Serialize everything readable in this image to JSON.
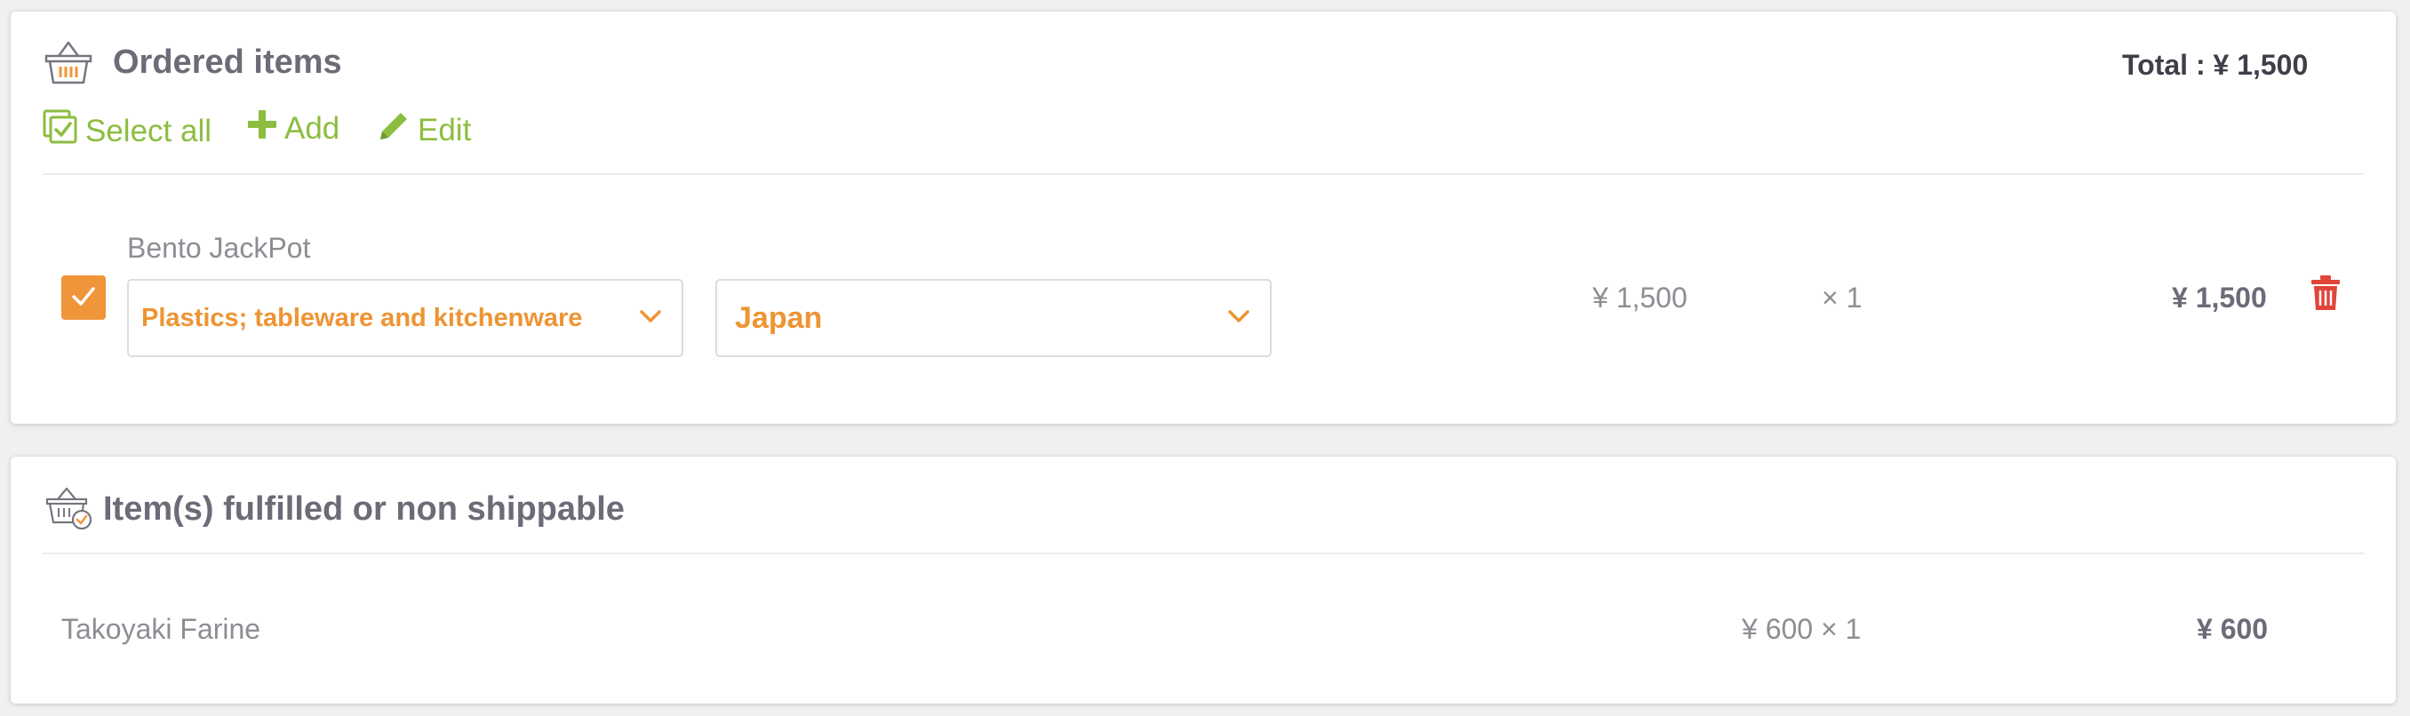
{
  "ordered": {
    "title": "Ordered items",
    "total": "Total : ¥ 1,500",
    "actions": {
      "select_all": "Select all",
      "add": "Add",
      "edit": "Edit"
    },
    "item": {
      "checked": true,
      "name": "Bento JackPot",
      "category": "Plastics; tableware and kitchenware",
      "country": "Japan",
      "unit_price": "¥ 1,500",
      "quantity": "× 1",
      "line_total": "¥ 1,500"
    }
  },
  "fulfilled": {
    "title": "Item(s) fulfilled or non shippable",
    "item": {
      "name": "Takoyaki Farine",
      "price_qty": "¥ 600 × 1",
      "line_total": "¥ 600"
    }
  },
  "colors": {
    "accent_green": "#8cbd3f",
    "accent_orange": "#ee9433",
    "delete_red": "#e0443a",
    "title_gray": "#6e6a78"
  },
  "icons": {
    "basket": "basket-icon",
    "basket_check": "basket-check-icon",
    "select_all": "select-all-icon",
    "add": "plus-icon",
    "edit": "pencil-icon",
    "checkbox": "check-icon",
    "dropdown": "chevron-down-icon",
    "delete": "trash-icon"
  }
}
